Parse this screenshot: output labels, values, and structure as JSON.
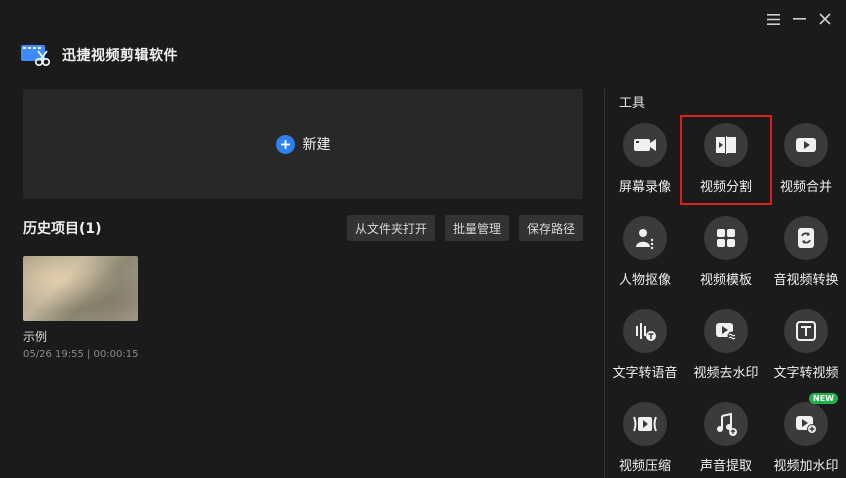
{
  "app": {
    "title": "迅捷视频剪辑软件"
  },
  "window_controls": {
    "menu_icon": "menu-icon",
    "minimize_icon": "minimize-icon",
    "close_icon": "close-icon"
  },
  "new_project": {
    "label": "新建",
    "icon": "plus-circle-icon",
    "accent": "#2f7ff0"
  },
  "history": {
    "title": "历史项目(1)",
    "actions": [
      "从文件夹打开",
      "批量管理",
      "保存路径"
    ],
    "items": [
      {
        "name": "示例",
        "meta": "05/26 19:55 | 00:00:15"
      }
    ]
  },
  "tools": {
    "title": "工具",
    "items": [
      {
        "label": "屏幕录像",
        "icon": "video-camera-icon"
      },
      {
        "label": "视频分割",
        "icon": "film-split-icon",
        "selected": true
      },
      {
        "label": "视频合并",
        "icon": "play-merge-icon"
      },
      {
        "label": "人物抠像",
        "icon": "portrait-cutout-icon"
      },
      {
        "label": "视频模板",
        "icon": "template-icon"
      },
      {
        "label": "音视频转换",
        "icon": "convert-icon"
      },
      {
        "label": "文字转语音",
        "icon": "text-to-speech-icon"
      },
      {
        "label": "视频去水印",
        "icon": "remove-watermark-icon"
      },
      {
        "label": "文字转视频",
        "icon": "text-to-video-icon"
      },
      {
        "label": "视频压缩",
        "icon": "compress-icon"
      },
      {
        "label": "声音提取",
        "icon": "audio-extract-icon"
      },
      {
        "label": "视频加水印",
        "icon": "add-watermark-icon",
        "badge": "NEW"
      }
    ]
  },
  "colors": {
    "background": "#1b1b1b",
    "panel": "#282828",
    "highlight": "#e02020",
    "badge": "#21b14a"
  }
}
